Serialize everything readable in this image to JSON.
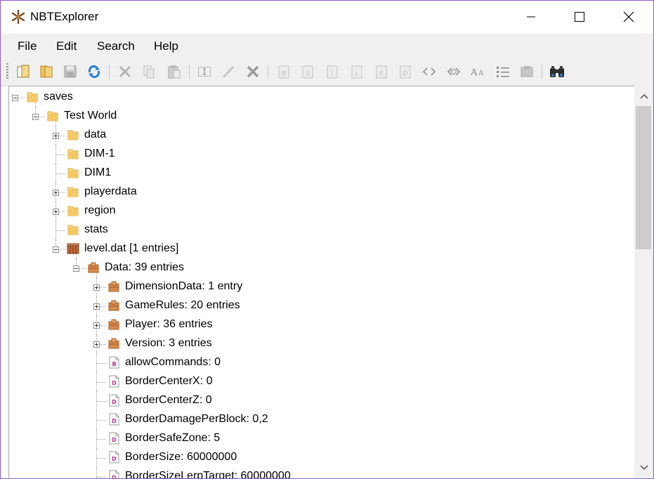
{
  "window": {
    "title": "NBTExplorer"
  },
  "menu": [
    "File",
    "Edit",
    "Search",
    "Help"
  ],
  "toolbar": {
    "buttons": [
      "open-file-icon",
      "open-folder-icon",
      "save-icon",
      "refresh-icon",
      "cut-icon",
      "copy-icon",
      "paste-icon",
      "rename-icon",
      "edit-icon",
      "delete-icon",
      "add-byte-icon",
      "add-short-icon",
      "add-int-icon",
      "add-long-icon",
      "add-float-icon",
      "add-double-icon",
      "add-byte-array-icon",
      "add-int-array-icon",
      "add-string-icon",
      "add-list-icon",
      "add-compound-icon",
      "find-icon"
    ]
  },
  "tree": {
    "nodes": [
      {
        "label": "saves",
        "icon": "folder-icon",
        "expander": "minus"
      },
      {
        "label": "Test World",
        "icon": "folder-icon",
        "expander": "minus"
      },
      {
        "label": "data",
        "icon": "folder-icon",
        "expander": "plus"
      },
      {
        "label": "DIM-1",
        "icon": "folder-icon",
        "expander": "none"
      },
      {
        "label": "DIM1",
        "icon": "folder-icon",
        "expander": "none"
      },
      {
        "label": "playerdata",
        "icon": "folder-icon",
        "expander": "plus"
      },
      {
        "label": "region",
        "icon": "folder-icon",
        "expander": "plus"
      },
      {
        "label": "stats",
        "icon": "folder-icon",
        "expander": "none"
      },
      {
        "label": "level.dat [1 entries]",
        "icon": "nbt-file-icon",
        "expander": "minus"
      },
      {
        "label": "Data: 39 entries",
        "icon": "compound-icon",
        "expander": "minus"
      },
      {
        "label": "DimensionData: 1 entry",
        "icon": "compound-icon",
        "expander": "plus"
      },
      {
        "label": "GameRules: 20 entries",
        "icon": "compound-icon",
        "expander": "plus"
      },
      {
        "label": "Player: 36 entries",
        "icon": "compound-icon",
        "expander": "plus"
      },
      {
        "label": "Version: 3 entries",
        "icon": "compound-icon",
        "expander": "plus"
      },
      {
        "label": "allowCommands: 0",
        "icon": "byte-tag-icon",
        "tag": "B",
        "expander": "none"
      },
      {
        "label": "BorderCenterX: 0",
        "icon": "double-tag-icon",
        "tag": "D",
        "expander": "none"
      },
      {
        "label": "BorderCenterZ: 0",
        "icon": "double-tag-icon",
        "tag": "D",
        "expander": "none"
      },
      {
        "label": "BorderDamagePerBlock: 0,2",
        "icon": "double-tag-icon",
        "tag": "D",
        "expander": "none"
      },
      {
        "label": "BorderSafeZone: 5",
        "icon": "double-tag-icon",
        "tag": "D",
        "expander": "none"
      },
      {
        "label": "BorderSize: 60000000",
        "icon": "double-tag-icon",
        "tag": "D",
        "expander": "none"
      },
      {
        "label": "BorderSizeLerpTarget: 60000000",
        "icon": "double-tag-icon",
        "tag": "D",
        "expander": "none"
      }
    ]
  },
  "colors": {
    "window_border": "#8a5cc1",
    "folder": "#f5c865",
    "compound": "#d68a4a",
    "tag_letter": "#c0308a"
  }
}
